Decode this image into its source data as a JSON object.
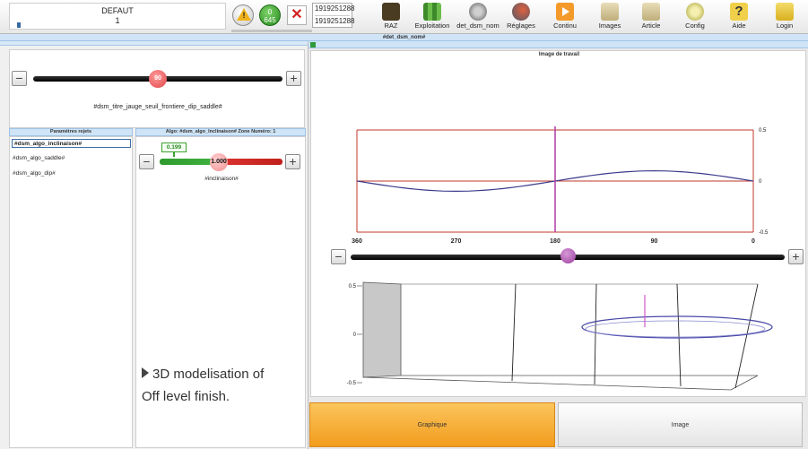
{
  "toolbar": {
    "profile_name": "DEFAUT",
    "profile_number": "1",
    "counter_top": "0",
    "counter_bottom": "645",
    "ids": [
      "1919251288",
      "1919251288"
    ],
    "items": [
      {
        "label": "RAZ",
        "icon": "reset-counter-icon",
        "color": "#5a4a2a"
      },
      {
        "label": "Exploitation",
        "icon": "bar-chart-icon",
        "color": "#5aa33a"
      },
      {
        "label": "det_dsm_nom",
        "icon": "stack-icon",
        "color": "#8a8a8a"
      },
      {
        "label": "Réglages",
        "icon": "settings-sliders-icon",
        "color": "#b04a3a"
      },
      {
        "label": "Continu",
        "icon": "play-icon",
        "color": "#f39a2b"
      },
      {
        "label": "Images",
        "icon": "images-icon",
        "color": "#c9b98a"
      },
      {
        "label": "Article",
        "icon": "article-icon",
        "color": "#c9b98a"
      },
      {
        "label": "Config",
        "icon": "gear-icon",
        "color": "#c9c36a"
      },
      {
        "label": "Aide",
        "icon": "help-icon",
        "color": "#e5c84a"
      },
      {
        "label": "Login",
        "icon": "lock-icon",
        "color": "#e5c84a"
      }
    ]
  },
  "title_strip": "#det_dsm_nom#",
  "gauge": {
    "value": 90,
    "minus": "−",
    "plus": "+",
    "title": "#dsm_titre_jauge_seuil_frontiere_dip_saddle#"
  },
  "params_panel": {
    "title": "Paramètres rejets",
    "items": [
      "#dsm_algo_inclinaison#",
      "#dsm_algo_saddle#",
      "#dsm_algo_dip#"
    ]
  },
  "algo_panel": {
    "title": "Algo: #dsm_algo_Inclinaison# Zone Numéro: 1",
    "low_value": "0.199",
    "value": "1.000",
    "label": "#inclinaison#"
  },
  "caption": {
    "line1": "3D modelisation of",
    "line2": "Off level finish."
  },
  "work_area": {
    "title": "Image de travail",
    "range_value": 180
  },
  "chart_data": {
    "type": "line",
    "x": [
      360,
      270,
      180,
      90,
      0
    ],
    "x_tick_labels": [
      "360",
      "270",
      "180",
      "90",
      "0"
    ],
    "y_tick_labels": [
      "0.5",
      "0",
      "-0.5"
    ],
    "ylim": [
      -0.5,
      0.5
    ],
    "xlim": [
      360,
      0
    ],
    "marker_x": 180,
    "series": [
      {
        "color": "#3a3a8c",
        "values": [
          0,
          -0.1,
          0,
          0.1,
          0
        ]
      }
    ],
    "line_colors": {
      "frame": "#c0392b",
      "marker": "#b03aa3"
    }
  },
  "view3d": {
    "y_tick_labels": [
      "0.5",
      "0",
      "-0.5"
    ]
  },
  "buttons": {
    "graph": "Graphique",
    "image": "Image"
  }
}
